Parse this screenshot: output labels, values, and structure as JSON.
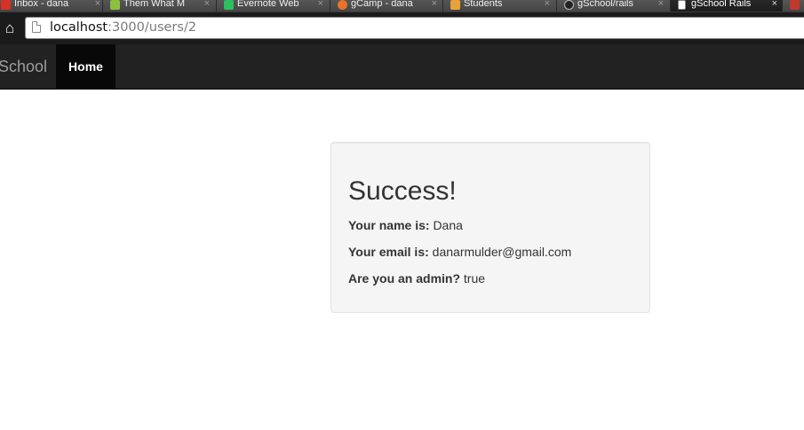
{
  "browser": {
    "tabs": [
      {
        "label": "Inbox - dana",
        "favicon_color": "#d93025",
        "active": false
      },
      {
        "label": "Them What M",
        "favicon_color": "#8fbf3f",
        "active": false
      },
      {
        "label": "Evernote Web",
        "favicon_color": "#2dbe60",
        "active": false
      },
      {
        "label": "gCamp - dana",
        "favicon_color": "#e8732a",
        "active": false
      },
      {
        "label": "Students",
        "favicon_color": "#e8a23a",
        "active": false
      },
      {
        "label": "gSchool/rails",
        "favicon_color": "#222222",
        "active": false
      },
      {
        "label": "gSchool Rails",
        "favicon_color": "#ffffff",
        "active": true
      }
    ],
    "tab_close_glyph": "×",
    "home_icon": "home-icon",
    "url_host": "localhost",
    "url_path": ":3000/users/2"
  },
  "navbar": {
    "brand": "gSchool",
    "home_link": "Home"
  },
  "panel": {
    "title": "Success!",
    "name_label": "Your name is:",
    "name_value": "Dana",
    "email_label": "Your email is:",
    "email_value": "danarmulder@gmail.com",
    "admin_label": "Are you an admin?",
    "admin_value": "true"
  },
  "colors": {
    "navbar_bg": "#222222",
    "nav_active_bg": "#080808",
    "panel_bg": "#f5f5f5",
    "text": "#333333"
  }
}
